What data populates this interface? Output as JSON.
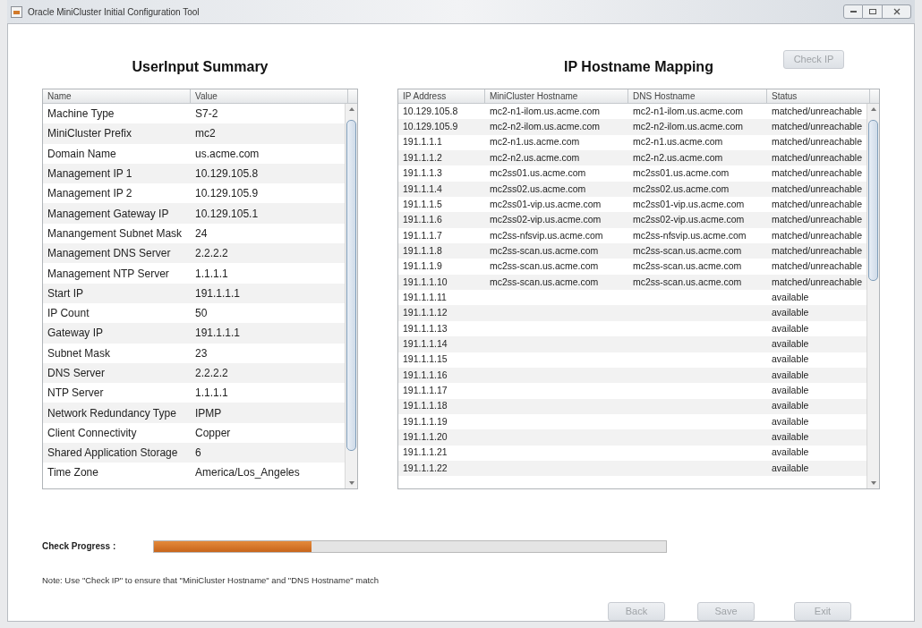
{
  "window": {
    "title": "Oracle MiniCluster Initial Configuration Tool"
  },
  "summary": {
    "title": "UserInput Summary",
    "columns": [
      "Name",
      "Value"
    ],
    "rows": [
      {
        "name": "Machine Type",
        "value": "S7-2"
      },
      {
        "name": "MiniCluster Prefix",
        "value": "mc2"
      },
      {
        "name": "Domain Name",
        "value": "us.acme.com"
      },
      {
        "name": "Management IP 1",
        "value": "10.129.105.8"
      },
      {
        "name": "Management IP 2",
        "value": "10.129.105.9"
      },
      {
        "name": "Management Gateway IP",
        "value": "10.129.105.1"
      },
      {
        "name": "Manangement Subnet Mask",
        "value": "24"
      },
      {
        "name": "Management DNS Server",
        "value": "2.2.2.2"
      },
      {
        "name": "Management NTP Server",
        "value": "1.1.1.1"
      },
      {
        "name": "Start IP",
        "value": "191.1.1.1"
      },
      {
        "name": "IP Count",
        "value": "50"
      },
      {
        "name": "Gateway IP",
        "value": "191.1.1.1"
      },
      {
        "name": "Subnet Mask",
        "value": "23"
      },
      {
        "name": "DNS Server",
        "value": "2.2.2.2"
      },
      {
        "name": "NTP Server",
        "value": "1.1.1.1"
      },
      {
        "name": "Network Redundancy Type",
        "value": "IPMP"
      },
      {
        "name": "Client Connectivity",
        "value": "Copper"
      },
      {
        "name": "Shared Application Storage",
        "value": "6"
      },
      {
        "name": "Time Zone",
        "value": "America/Los_Angeles"
      }
    ]
  },
  "mapping": {
    "title": "IP Hostname Mapping",
    "check_button": {
      "label": "Check IP",
      "disabled": true
    },
    "columns": [
      "IP Address",
      "MiniCluster Hostname",
      "DNS Hostname",
      "Status"
    ],
    "rows": [
      {
        "ip": "10.129.105.8",
        "minicluster_hostname": "mc2-n1-ilom.us.acme.com",
        "dns_hostname": "mc2-n1-ilom.us.acme.com",
        "status": "matched/unreachable"
      },
      {
        "ip": "10.129.105.9",
        "minicluster_hostname": "mc2-n2-ilom.us.acme.com",
        "dns_hostname": "mc2-n2-ilom.us.acme.com",
        "status": "matched/unreachable"
      },
      {
        "ip": "191.1.1.1",
        "minicluster_hostname": "mc2-n1.us.acme.com",
        "dns_hostname": "mc2-n1.us.acme.com",
        "status": "matched/unreachable"
      },
      {
        "ip": "191.1.1.2",
        "minicluster_hostname": "mc2-n2.us.acme.com",
        "dns_hostname": "mc2-n2.us.acme.com",
        "status": "matched/unreachable"
      },
      {
        "ip": "191.1.1.3",
        "minicluster_hostname": "mc2ss01.us.acme.com",
        "dns_hostname": "mc2ss01.us.acme.com",
        "status": "matched/unreachable"
      },
      {
        "ip": "191.1.1.4",
        "minicluster_hostname": "mc2ss02.us.acme.com",
        "dns_hostname": "mc2ss02.us.acme.com",
        "status": "matched/unreachable"
      },
      {
        "ip": "191.1.1.5",
        "minicluster_hostname": "mc2ss01-vip.us.acme.com",
        "dns_hostname": "mc2ss01-vip.us.acme.com",
        "status": "matched/unreachable"
      },
      {
        "ip": "191.1.1.6",
        "minicluster_hostname": "mc2ss02-vip.us.acme.com",
        "dns_hostname": "mc2ss02-vip.us.acme.com",
        "status": "matched/unreachable"
      },
      {
        "ip": "191.1.1.7",
        "minicluster_hostname": "mc2ss-nfsvip.us.acme.com",
        "dns_hostname": "mc2ss-nfsvip.us.acme.com",
        "status": "matched/unreachable"
      },
      {
        "ip": "191.1.1.8",
        "minicluster_hostname": "mc2ss-scan.us.acme.com",
        "dns_hostname": "mc2ss-scan.us.acme.com",
        "status": "matched/unreachable"
      },
      {
        "ip": "191.1.1.9",
        "minicluster_hostname": "mc2ss-scan.us.acme.com",
        "dns_hostname": "mc2ss-scan.us.acme.com",
        "status": "matched/unreachable"
      },
      {
        "ip": "191.1.1.10",
        "minicluster_hostname": "mc2ss-scan.us.acme.com",
        "dns_hostname": "mc2ss-scan.us.acme.com",
        "status": "matched/unreachable"
      },
      {
        "ip": "191.1.1.11",
        "status": "available"
      },
      {
        "ip": "191.1.1.12",
        "status": "available"
      },
      {
        "ip": "191.1.1.13",
        "status": "available"
      },
      {
        "ip": "191.1.1.14",
        "status": "available"
      },
      {
        "ip": "191.1.1.15",
        "status": "available"
      },
      {
        "ip": "191.1.1.16",
        "status": "available"
      },
      {
        "ip": "191.1.1.17",
        "status": "available"
      },
      {
        "ip": "191.1.1.18",
        "status": "available"
      },
      {
        "ip": "191.1.1.19",
        "status": "available"
      },
      {
        "ip": "191.1.1.20",
        "status": "available"
      },
      {
        "ip": "191.1.1.21",
        "status": "available"
      },
      {
        "ip": "191.1.1.22",
        "status": "available"
      }
    ]
  },
  "progress": {
    "label": "Check Progress :",
    "level": 0.307
  },
  "note": "Note: Use \"Check IP\" to ensure that \"MiniCluster Hostname\" and \"DNS Hostname\" match",
  "buttons": [
    {
      "label": "Back",
      "disabled": true
    },
    {
      "label": "Save",
      "disabled": true
    },
    {
      "label": "Exit",
      "disabled": true
    }
  ]
}
